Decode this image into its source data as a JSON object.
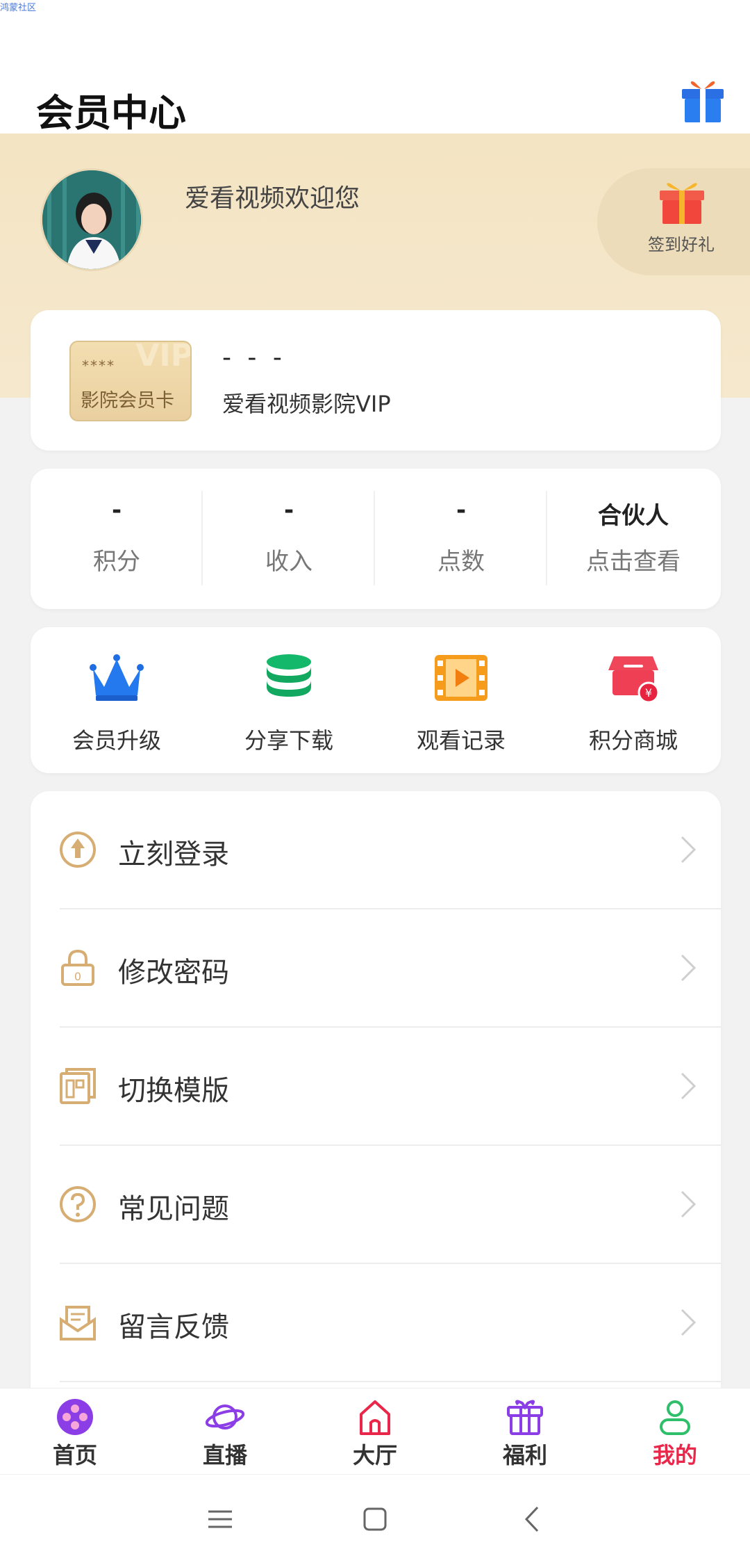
{
  "status_bar": {
    "app_label": "鸿蒙社区"
  },
  "header": {
    "title": "会员中心"
  },
  "profile": {
    "welcome": "爱看视频欢迎您",
    "signin_label": "签到好礼"
  },
  "vip_card": {
    "badge_stars": "****",
    "badge_vip": "VIP",
    "badge_text": "影院会员卡",
    "value": "- - -",
    "name": "爱看视频影院VIP"
  },
  "stats": [
    {
      "value": "-",
      "label": "积分"
    },
    {
      "value": "-",
      "label": "收入"
    },
    {
      "value": "-",
      "label": "点数"
    },
    {
      "value": "合伙人",
      "label": "点击查看"
    }
  ],
  "quick_actions": [
    {
      "label": "会员升级",
      "icon": "crown-icon"
    },
    {
      "label": "分享下载",
      "icon": "coin-stack-icon"
    },
    {
      "label": "观看记录",
      "icon": "film-icon"
    },
    {
      "label": "积分商城",
      "icon": "store-icon"
    }
  ],
  "menu": [
    {
      "label": "立刻登录",
      "icon": "upload-icon"
    },
    {
      "label": "修改密码",
      "icon": "lock-icon"
    },
    {
      "label": "切换模版",
      "icon": "template-icon"
    },
    {
      "label": "常见问题",
      "icon": "question-icon"
    },
    {
      "label": "留言反馈",
      "icon": "mail-icon"
    }
  ],
  "tabs": [
    {
      "label": "首页",
      "icon": "film-reel-icon"
    },
    {
      "label": "直播",
      "icon": "planet-icon"
    },
    {
      "label": "大厅",
      "icon": "house-icon"
    },
    {
      "label": "福利",
      "icon": "gift-icon"
    },
    {
      "label": "我的",
      "icon": "user-icon",
      "active": true
    }
  ],
  "colors": {
    "accent_gold": "#d9b27a",
    "banner": "#f3e4c3",
    "active_tab": "#e8274a"
  }
}
